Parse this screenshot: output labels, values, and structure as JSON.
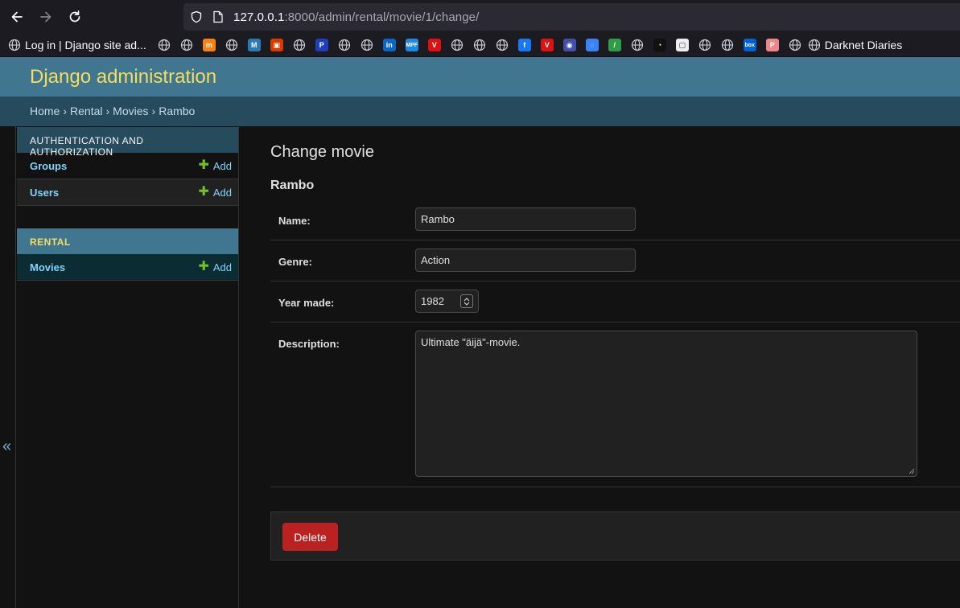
{
  "browser": {
    "url_host": "127.0.0.1",
    "url_rest": ":8000/admin/rental/movie/1/change/",
    "bookmark_first": "Log in | Django site ad...",
    "bookmark_last": "Darknet Diaries"
  },
  "bookmark_icons": [
    {
      "name": "globe",
      "color": "#cfcfd8"
    },
    {
      "name": "globe",
      "color": "#cfcfd8"
    },
    {
      "name": "moodle",
      "color": "#f98012",
      "glyph": "m"
    },
    {
      "name": "globe",
      "color": "#cfcfd8"
    },
    {
      "name": "metro",
      "color": "#2a7ab8",
      "glyph": "M"
    },
    {
      "name": "office",
      "color": "#d83b01",
      "glyph": "▣"
    },
    {
      "name": "globe",
      "color": "#cfcfd8"
    },
    {
      "name": "pe",
      "color": "#1d3fbb",
      "glyph": "P"
    },
    {
      "name": "globe",
      "color": "#cfcfd8"
    },
    {
      "name": "globe",
      "color": "#cfcfd8"
    },
    {
      "name": "linkedin",
      "color": "#0a66c2",
      "glyph": "in"
    },
    {
      "name": "mpf",
      "color": "#1e88e5",
      "glyph": "MPF"
    },
    {
      "name": "v-red",
      "color": "#d11",
      "glyph": "V"
    },
    {
      "name": "globe",
      "color": "#cfcfd8"
    },
    {
      "name": "globe",
      "color": "#cfcfd8"
    },
    {
      "name": "globe",
      "color": "#cfcfd8"
    },
    {
      "name": "facebook",
      "color": "#1877f2",
      "glyph": "f"
    },
    {
      "name": "v-red",
      "color": "#d11",
      "glyph": "V"
    },
    {
      "name": "circle-blue",
      "color": "#4450a8",
      "glyph": "◉"
    },
    {
      "name": "spinner",
      "color": "#3b82f6",
      "glyph": "◌"
    },
    {
      "name": "leaf",
      "color": "#2e9d45",
      "glyph": "/"
    },
    {
      "name": "globe",
      "color": "#cfcfd8"
    },
    {
      "name": "speedometer",
      "color": "#111",
      "glyph": "◔"
    },
    {
      "name": "bag",
      "color": "#eee",
      "glyph": "▢"
    },
    {
      "name": "globe",
      "color": "#cfcfd8"
    },
    {
      "name": "globe",
      "color": "#cfcfd8"
    },
    {
      "name": "box",
      "color": "#0061d5",
      "glyph": "box"
    },
    {
      "name": "p-pink",
      "color": "#e88",
      "glyph": "P"
    },
    {
      "name": "globe",
      "color": "#cfcfd8"
    }
  ],
  "admin": {
    "branding": "Django administration",
    "breadcrumbs": [
      "Home",
      "Rental",
      "Movies",
      "Rambo"
    ],
    "breadcrumb_sep": "›",
    "toggle_glyph": "«"
  },
  "sidebar": {
    "auth_caption": "AUTHENTICATION AND AUTHORIZATION",
    "auth_items": [
      {
        "label": "Groups",
        "add": "Add"
      },
      {
        "label": "Users",
        "add": "Add"
      }
    ],
    "rental_caption": "RENTAL",
    "rental_items": [
      {
        "label": "Movies",
        "add": "Add"
      }
    ],
    "plus": "✚"
  },
  "content": {
    "title": "Change movie",
    "object": "Rambo",
    "fields": {
      "name_label": "Name:",
      "name_value": "Rambo",
      "genre_label": "Genre:",
      "genre_value": "Action",
      "year_label": "Year made:",
      "year_value": "1982",
      "description_label": "Description:",
      "description_value": "Ultimate \"äijä\"-movie."
    },
    "delete_label": "Delete"
  },
  "colors": {
    "header": "#417690",
    "branding": "#f5dd5d",
    "breadcrumbs": "#264b5d",
    "link": "#81d4fa",
    "add_plus": "#70bf2b",
    "delete": "#ba2121"
  }
}
